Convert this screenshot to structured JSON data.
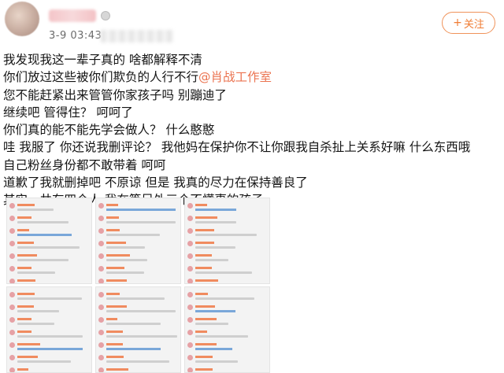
{
  "post": {
    "timestamp": "3-9 03:43",
    "follow_button": {
      "plus": "+",
      "label": "关注"
    },
    "lines": [
      {
        "text": "我发现我这一辈子真的 啥都解释不清"
      },
      {
        "text": "你们放过这些被你们欺负的人行不行",
        "mention": "@肖战工作室"
      },
      {
        "text": "您不能赶紧出来管管你家孩子吗 别蹦迪了"
      },
      {
        "text": "继续吧 管得住？ 呵呵了"
      },
      {
        "text": "你们真的能不能先学会做人？ 什么憨憨"
      },
      {
        "text": "哇 我服了 你还说我删评论？ 我他妈在保护你不让你跟我自杀扯上关系好嘛 什么东西哦"
      },
      {
        "text": "自己粉丝身份都不敢带着 呵呵"
      },
      {
        "text": "道歉了我就删掉吧 不原谅 但是 我真的尽力在保持善良了"
      },
      {
        "text": "其实一共有四个人 我在等另外三个不懂事的孩子"
      }
    ]
  },
  "icons": {
    "avatar": "avatar-icon",
    "verify": "verified-badge-icon",
    "follow": "plus-icon"
  },
  "colors": {
    "accent": "#eb7350",
    "follow_border": "#f0935a",
    "timestamp": "#6b6b6b"
  }
}
